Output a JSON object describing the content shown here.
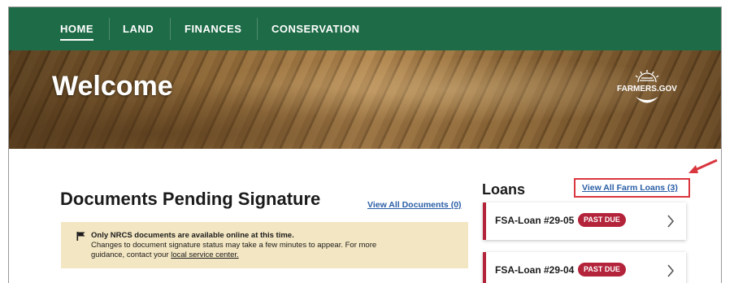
{
  "nav": {
    "items": [
      {
        "label": "HOME",
        "active": true
      },
      {
        "label": "LAND",
        "active": false
      },
      {
        "label": "FINANCES",
        "active": false
      },
      {
        "label": "CONSERVATION",
        "active": false
      }
    ]
  },
  "hero": {
    "title": "Welcome",
    "logo_text": "FARMERS.GOV"
  },
  "documents": {
    "title": "Documents Pending Signature",
    "view_all_label": "View All Documents (0)",
    "notice": {
      "bold_text": "Only NRCS documents are available online at this time.",
      "line1": "Changes to document signature status may take a few minutes to appear. For more",
      "line2_prefix": "guidance, contact your ",
      "link_text": "local service center."
    }
  },
  "loans": {
    "title": "Loans",
    "view_all_label": "View All Farm Loans (3)",
    "items": [
      {
        "name": "FSA-Loan #29-05",
        "status": "PAST DUE"
      },
      {
        "name": "FSA-Loan #29-04",
        "status": "PAST DUE"
      }
    ]
  },
  "colors": {
    "nav_green": "#1e6b47",
    "past_due_red": "#b3233a",
    "link_blue": "#2a5ea6",
    "notice_bg": "#f3e6c2",
    "highlight_red": "#d9363e"
  }
}
